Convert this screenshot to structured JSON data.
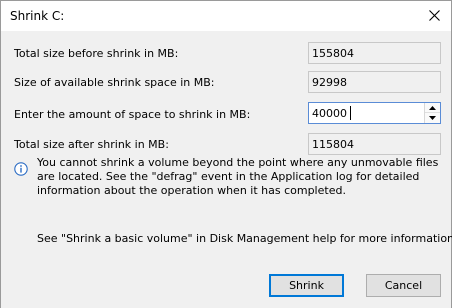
{
  "dialog": {
    "title": "Shrink C:",
    "close_icon": "close-icon"
  },
  "fields": {
    "total_size_before": {
      "label": "Total size before shrink in MB:",
      "value": "155804"
    },
    "available_shrink": {
      "label": "Size of available shrink space in MB:",
      "value": "92998"
    },
    "amount_to_shrink": {
      "label": "Enter the amount of space to shrink in MB:",
      "value": "40000"
    },
    "total_size_after": {
      "label": "Total size after shrink in MB:",
      "value": "115804"
    }
  },
  "info": {
    "icon": "info-icon",
    "text": "You cannot shrink a volume beyond the point where any unmovable files are located. See the \"defrag\" event in the Application log for detailed information about the operation when it has completed."
  },
  "help": {
    "text": "See \"Shrink a basic volume\" in Disk Management help for more information"
  },
  "buttons": {
    "shrink": "Shrink",
    "cancel": "Cancel"
  },
  "colors": {
    "focus_border": "#0078d7",
    "dialog_bg": "#f0f0f0",
    "info_icon": "#2b6cc4"
  }
}
